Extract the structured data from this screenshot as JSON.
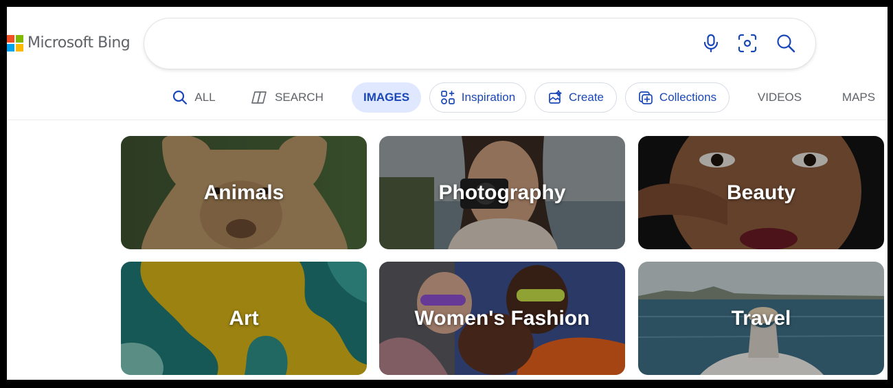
{
  "logo": {
    "text": "Microsoft Bing"
  },
  "search": {
    "value": "",
    "placeholder": ""
  },
  "icons": {
    "mic": "microphone-icon",
    "visual": "visual-search-icon",
    "search": "search-icon"
  },
  "tabs": [
    {
      "label": "ALL",
      "icon": "search-icon"
    },
    {
      "label": "SEARCH",
      "icon": "copilot-icon"
    },
    {
      "label": "IMAGES",
      "active": true
    },
    {
      "label": "Inspiration",
      "icon": "sparkle-grid-icon"
    },
    {
      "label": "Create",
      "icon": "image-create-icon"
    },
    {
      "label": "Collections",
      "icon": "collections-icon"
    },
    {
      "label": "VIDEOS"
    },
    {
      "label": "MAPS"
    }
  ],
  "categories": [
    {
      "label": "Animals"
    },
    {
      "label": "Photography"
    },
    {
      "label": "Beauty"
    },
    {
      "label": "Art"
    },
    {
      "label": "Women's Fashion"
    },
    {
      "label": "Travel"
    }
  ],
  "colors": {
    "accent": "#1a47b8",
    "active_tab_bg": "#dfe8ff"
  }
}
